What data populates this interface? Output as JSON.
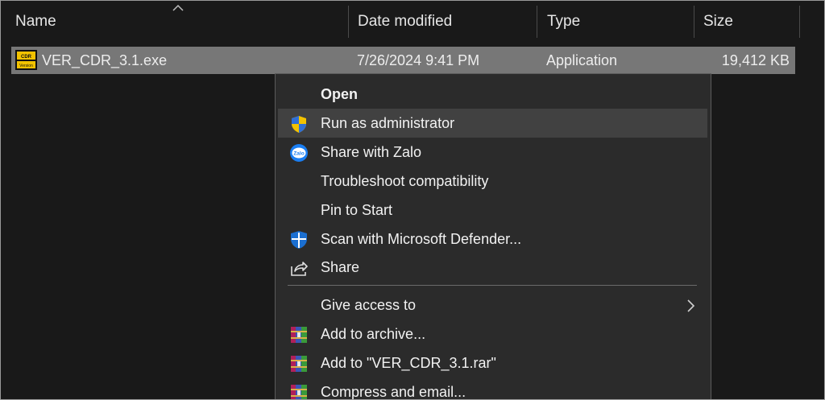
{
  "columns": {
    "name": "Name",
    "date": "Date modified",
    "type": "Type",
    "size": "Size"
  },
  "file": {
    "name": "VER_CDR_3.1.exe",
    "date": "7/26/2024 9:41 PM",
    "type": "Application",
    "size": "19,412 KB",
    "icon": "cdr-app-icon",
    "icon_text_top": "CDR",
    "icon_text_bottom": "Version"
  },
  "context_menu": {
    "items": [
      {
        "label": "Open",
        "icon": "none"
      },
      {
        "label": "Run as administrator",
        "icon": "uac-shield-icon"
      },
      {
        "label": "Share with Zalo",
        "icon": "zalo-icon"
      },
      {
        "label": "Troubleshoot compatibility",
        "icon": "none"
      },
      {
        "label": "Pin to Start",
        "icon": "none"
      },
      {
        "label": "Scan with Microsoft Defender...",
        "icon": "defender-shield-icon"
      },
      {
        "label": "Share",
        "icon": "share-icon"
      },
      {
        "label": "Give access to",
        "icon": "none",
        "submenu": true
      },
      {
        "label": "Add to archive...",
        "icon": "winrar-icon"
      },
      {
        "label": "Add to \"VER_CDR_3.1.rar\"",
        "icon": "winrar-icon"
      },
      {
        "label": "Compress and email...",
        "icon": "winrar-icon"
      }
    ],
    "zalo_icon_text": "Zalo"
  },
  "colors": {
    "background": "#191919",
    "selected_row": "#777777",
    "menu_bg": "#2b2b2b",
    "menu_hover": "#414141",
    "zalo_blue": "#1a7ef2",
    "defender_blue": "#1b6fd1"
  }
}
